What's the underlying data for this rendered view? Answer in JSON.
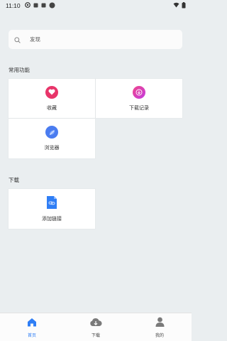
{
  "status_bar": {
    "time": "11:10",
    "icons": [
      "vpn-icon",
      "sim-icon",
      "sim-icon",
      "dot-icon",
      "wifi-icon",
      "battery-icon"
    ]
  },
  "search": {
    "placeholder": "发现"
  },
  "sections": {
    "common": {
      "title": "常用功能",
      "items": [
        {
          "label": "收藏",
          "icon": "heart-icon",
          "color": "#e8356a"
        },
        {
          "label": "下载记录",
          "icon": "download-arrow-icon",
          "color": "#e8356a"
        },
        {
          "label": "浏览器",
          "icon": "browser-leaf-icon",
          "color": "#4a7cf0"
        }
      ]
    },
    "download": {
      "title": "下载",
      "items": [
        {
          "label": "添加链接",
          "icon": "link-file-icon",
          "color": "#2f7ef5"
        }
      ]
    }
  },
  "tabbar": {
    "items": [
      {
        "label": "首页",
        "icon": "home-icon",
        "active": true
      },
      {
        "label": "下载",
        "icon": "cloud-download-icon",
        "active": false
      },
      {
        "label": "我的",
        "icon": "user-icon",
        "active": false
      }
    ],
    "active_color": "#2f7ef5",
    "inactive_color": "#7a7a7a"
  }
}
